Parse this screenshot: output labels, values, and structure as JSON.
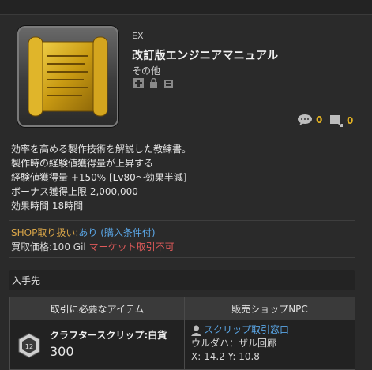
{
  "item": {
    "category": "EX",
    "name": "改訂版エンジニアマニュアル",
    "type": "その他",
    "comment_count": "0",
    "attach_count": "0"
  },
  "description": [
    "効率を高める製作技術を解説した教練書。",
    "製作時の経験値獲得量が上昇する",
    "経験値獲得量 +150% [Lv80～効果半減]",
    "ボーナス獲得上限 2,000,000",
    "効果時間 18時間"
  ],
  "shop": {
    "label": "SHOP取り扱い:",
    "value": "あり",
    "conditions": "(購入条件付)",
    "price_label": "買取価格:",
    "price": "100 Gil",
    "market": "マーケット取引不可"
  },
  "section_title": "入手先",
  "table": {
    "headers": [
      "取引に必要なアイテム",
      "販売ショップNPC"
    ],
    "currency_name": "クラフタースクリップ:白貨",
    "currency_qty": "300",
    "npc_name": "スクリップ取引窓口",
    "npc_area": "ウルダハ：ザル回廊",
    "npc_coords": "X: 14.2 Y: 10.8"
  },
  "colors": {
    "link": "#5aa6e6",
    "accent": "#d9a548",
    "warn": "#e05a5a"
  }
}
